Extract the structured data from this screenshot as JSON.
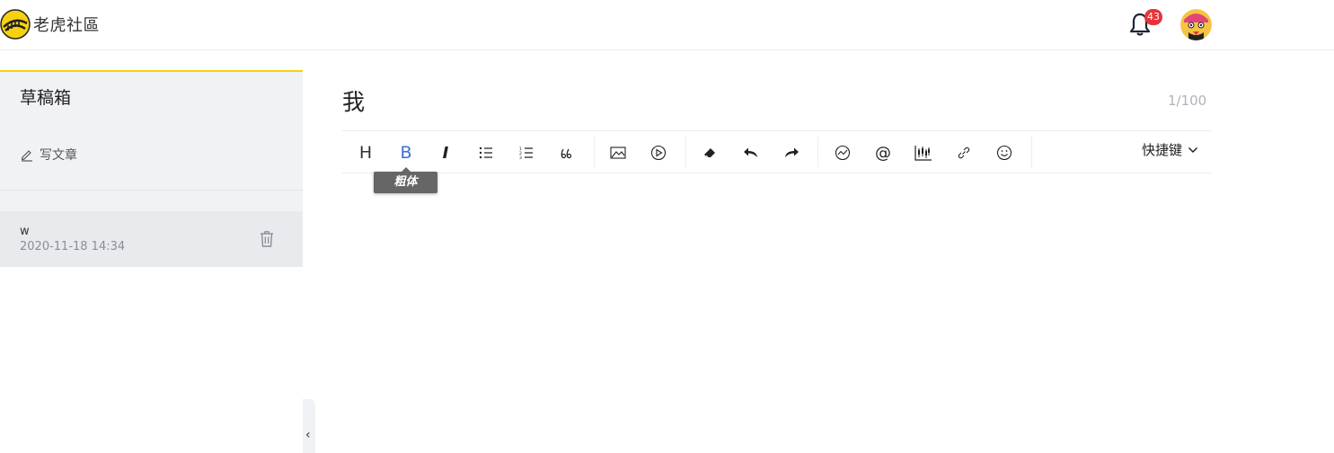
{
  "header": {
    "logo_text": "老虎社區",
    "notification_count": "43"
  },
  "sidebar": {
    "title": "草稿箱",
    "write_label": "写文章",
    "drafts": [
      {
        "title": "w",
        "date": "2020-11-18 14:34"
      }
    ]
  },
  "editor": {
    "title_value": "我",
    "counter": "1/100",
    "tooltip": "粗体",
    "shortcut_label": "快捷键",
    "toolbar_labels": {
      "heading": "H",
      "bold": "B",
      "italic": "I",
      "mention": "@"
    }
  },
  "colors": {
    "accent": "#f7d10e",
    "badge": "#e8323a",
    "sidebar_bg": "#f1f2f6",
    "active_icon": "#3b6fd4"
  }
}
